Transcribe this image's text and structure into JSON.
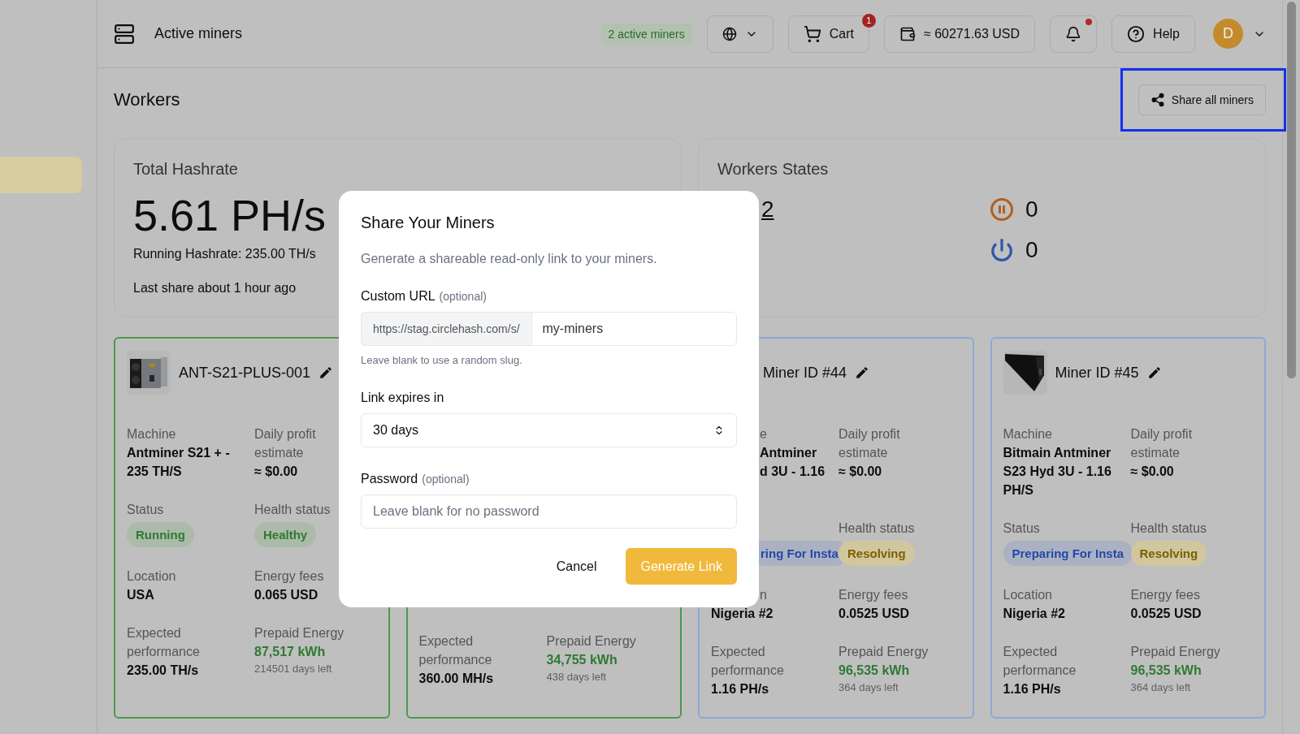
{
  "sidebar": {
    "items": [
      {
        "selected": true
      }
    ]
  },
  "header": {
    "title": "Active miners",
    "badge": "2 active miners",
    "cart": {
      "label": "Cart",
      "count": "1"
    },
    "balance": "≈ 60271.63 USD",
    "notifications": {
      "unread": true
    },
    "help": "Help",
    "avatar": "D"
  },
  "page": {
    "title": "Workers",
    "share_button": "Share all miners",
    "share_highlighted": true
  },
  "hashrate": {
    "title": "Total Hashrate",
    "value": "5.61 PH/s",
    "running": "Running Hashrate: 235.00 TH/s",
    "last_share": "Last share about 1 hour ago"
  },
  "workers_states": {
    "title": "Workers States",
    "states": [
      {
        "kind": "covered",
        "count": "2"
      },
      {
        "kind": "paused",
        "count": "0"
      },
      {
        "kind": "stopped",
        "count": "0"
      }
    ]
  },
  "miners": [
    {
      "title": "ANT-S21-PLUS-001",
      "color": "#4a9a4a",
      "kind": "rig",
      "fields": [
        {
          "label": "Machine",
          "value": "Antminer S21 + - 235 TH/S"
        },
        {
          "label": "Daily profit estimate",
          "value": "≈ $0.00"
        },
        {
          "label": "Status",
          "value": "Running",
          "kind": "pill",
          "color": "#abbaa9"
        },
        {
          "label": "Health status",
          "value": "Healthy",
          "kind": "pill",
          "color": "#abbaa9"
        },
        {
          "label": "Location",
          "value": "USA"
        },
        {
          "label": "Energy fees",
          "value": "0.065 USD"
        },
        {
          "label": "Expected performance",
          "value": "235.00 TH/s"
        },
        {
          "label": "Prepaid Energy",
          "value": "87,517 kWh",
          "note": "214501 days left",
          "kind": "energy"
        }
      ]
    },
    {
      "color": "#4a9a4a",
      "fields": [
        {
          "label": "Expected performance",
          "value": "360.00 MH/s"
        },
        {
          "label": "Prepaid Energy",
          "value": "34,755 kWh",
          "note": "438 days left",
          "kind": "energy"
        }
      ]
    },
    {
      "title": "Miner ID #44",
      "color": "#8ea8d4",
      "fields": [
        {
          "label": "e",
          "value": "Antminer\nd 3U - 1.16",
          "label_covered": true,
          "value_covered": true
        },
        {
          "label": "Daily profit estimate",
          "value": "≈ $0.00"
        },
        {
          "value": "ring For Insta",
          "kind": "pill",
          "color": "#aab1c2",
          "value_covered": true
        },
        {
          "label": "Health status",
          "value": "Resolving",
          "kind": "pill",
          "color": "#d1c79e"
        },
        {
          "label": "n",
          "value": "Nigeria #2",
          "label_covered": true
        },
        {
          "label": "Energy fees",
          "value": "0.0525 USD"
        },
        {
          "label": "Expected performance",
          "value": "1.16 PH/s"
        },
        {
          "label": "Prepaid Energy",
          "value": "96,535 kWh",
          "note": "364 days left",
          "kind": "energy"
        }
      ]
    },
    {
      "title": "Miner ID #45",
      "color": "#8ea8d4",
      "kind": "block",
      "fields": [
        {
          "label": "Machine",
          "value": "Bitmain Antminer S23 Hyd 3U - 1.16 PH/S"
        },
        {
          "label": "Daily profit estimate",
          "value": "≈ $0.00"
        },
        {
          "label": "Status",
          "value": "Preparing For Insta",
          "kind": "pill",
          "color": "#aab1c2"
        },
        {
          "label": "Health status",
          "value": "Resolving",
          "kind": "pill",
          "color": "#d1c79e"
        },
        {
          "label": "Location",
          "value": "Nigeria #2"
        },
        {
          "label": "Energy fees",
          "value": "0.0525 USD"
        },
        {
          "label": "Expected performance",
          "value": "1.16 PH/s"
        },
        {
          "label": "Prepaid Energy",
          "value": "96,535 kWh",
          "note": "364 days left",
          "kind": "energy"
        }
      ]
    }
  ],
  "share_dialog": {
    "title": "Share Your Miners",
    "description": "Generate a shareable read-only link to your miners.",
    "url": {
      "label": "Custom URL",
      "hint": "(optional)",
      "prefix": "https://stag.circlehash.com/s/",
      "value": "my-miners",
      "help": "Leave blank to use a random slug."
    },
    "expiry": {
      "label": "Link expires in",
      "value": "30 days"
    },
    "password": {
      "label": "Password",
      "hint": "(optional)",
      "placeholder": "Leave blank for no password"
    },
    "cancel": "Cancel",
    "submit": "Generate Link"
  }
}
